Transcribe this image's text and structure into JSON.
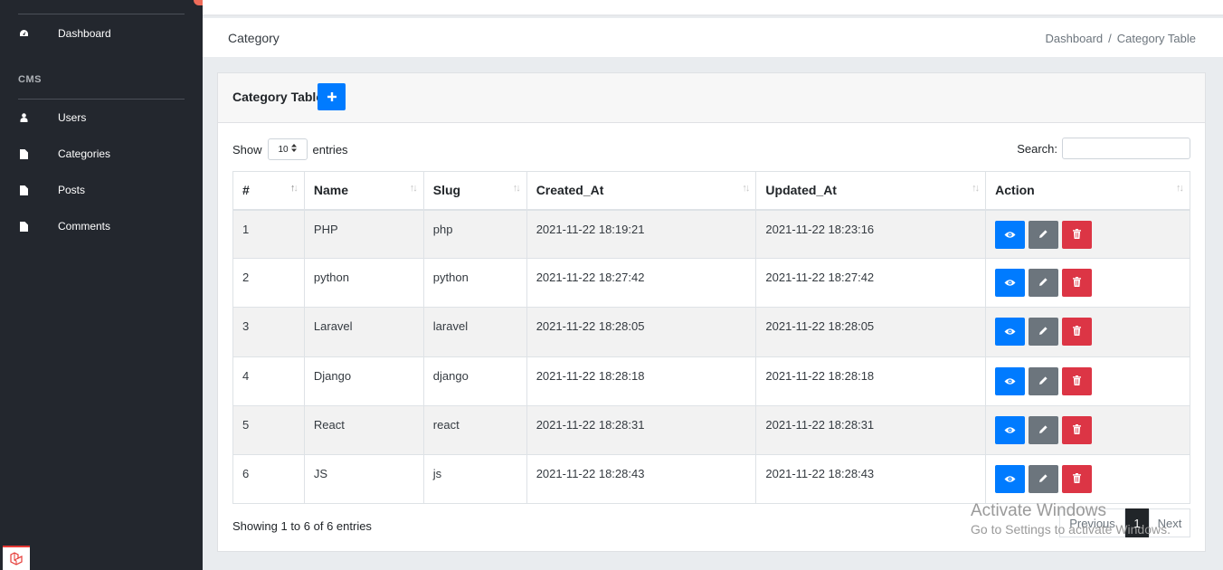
{
  "sidebar": {
    "items": [
      {
        "label": "Dashboard",
        "icon": "dashboard-icon"
      },
      {
        "label": "Users",
        "icon": "user-icon"
      },
      {
        "label": "Categories",
        "icon": "file-icon"
      },
      {
        "label": "Posts",
        "icon": "file-icon"
      },
      {
        "label": "Comments",
        "icon": "file-icon"
      }
    ],
    "section": "CMS"
  },
  "header": {
    "title": "Category",
    "breadcrumb": [
      "Dashboard",
      "/",
      "Category Table"
    ]
  },
  "card": {
    "title": "Category Table",
    "show_label": "Show",
    "length_value": "10",
    "entries_label": "entries",
    "search_label": "Search:",
    "search_value": "",
    "columns": [
      "#",
      "Name",
      "Slug",
      "Created_At",
      "Updated_At",
      "Action"
    ],
    "rows": [
      {
        "id": "1",
        "name": "PHP",
        "slug": "php",
        "created": "2021-11-22 18:19:21",
        "updated": "2021-11-22 18:23:16"
      },
      {
        "id": "2",
        "name": "python",
        "slug": "python",
        "created": "2021-11-22 18:27:42",
        "updated": "2021-11-22 18:27:42"
      },
      {
        "id": "3",
        "name": "Laravel",
        "slug": "laravel",
        "created": "2021-11-22 18:28:05",
        "updated": "2021-11-22 18:28:05"
      },
      {
        "id": "4",
        "name": "Django",
        "slug": "django",
        "created": "2021-11-22 18:28:18",
        "updated": "2021-11-22 18:28:18"
      },
      {
        "id": "5",
        "name": "React",
        "slug": "react",
        "created": "2021-11-22 18:28:31",
        "updated": "2021-11-22 18:28:31"
      },
      {
        "id": "6",
        "name": "JS",
        "slug": "js",
        "created": "2021-11-22 18:28:43",
        "updated": "2021-11-22 18:28:43"
      }
    ],
    "info": "Showing 1 to 6 of 6 entries",
    "pagination": {
      "previous": "Previous",
      "current": "1",
      "next": "Next"
    }
  },
  "watermark": {
    "line1": "Activate Windows",
    "line2": "Go to Settings to activate Windows."
  },
  "colors": {
    "primary": "#007bff",
    "secondary": "#6c757d",
    "danger": "#dc3545",
    "sidebar": "#23272e"
  }
}
